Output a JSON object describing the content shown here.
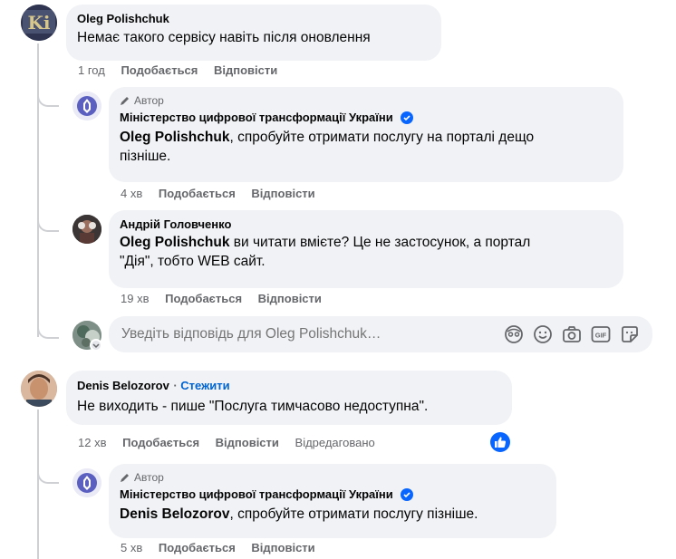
{
  "comments": [
    {
      "author": "Oleg Polishchuk",
      "text": "Немає такого сервісу навіть після оновлення",
      "time": "1 год",
      "like": "Подобається",
      "reply": "Відповісти"
    },
    {
      "author": "Denis Belozorov",
      "follow": "Стежити",
      "text": "Не виходить - пише \"Послуга тимчасово недоступна\".",
      "time": "12 хв",
      "like": "Подобається",
      "reply": "Відповісти",
      "edited": "Відредаговано"
    }
  ],
  "replies": [
    {
      "author_tag": "Автор",
      "author": "Міністерство цифрової трансформації України",
      "mention": "Oleg Polishchuk",
      "text_line1": ", спробуйте отримати послугу на порталі дещо",
      "text_line2": "пізніше.",
      "time": "4 хв",
      "like": "Подобається",
      "reply": "Відповісти"
    },
    {
      "author": "Андрій Головченко",
      "mention": "Oleg Polishchuk",
      "text_line1": " ви читати вмієте? Це не застосунок, а портал",
      "text_line2": "\"Дія\", тобто WEB сайт.",
      "time": "19 хв",
      "like": "Подобається",
      "reply": "Відповісти"
    },
    {
      "author_tag": "Автор",
      "author": "Міністерство цифрової трансформації України",
      "mention": "Denis Belozorov",
      "text_line1": ", спробуйте отримати послугу пізніше.",
      "time": "5 хв",
      "like": "Подобається",
      "reply": "Відповісти"
    }
  ],
  "reply_input": {
    "placeholder": "Уведіть відповідь для Oleg Polishchuk…"
  },
  "icons": [
    "avatar-sticker-icon",
    "emoji-icon",
    "camera-icon",
    "gif-icon",
    "sticker-icon",
    "like-reaction-icon",
    "pencil-icon",
    "verified-icon"
  ],
  "colors": {
    "bubble": "#f0f2f5",
    "meta": "#65676b",
    "link": "#0064d1",
    "verified": "#0866ff"
  }
}
